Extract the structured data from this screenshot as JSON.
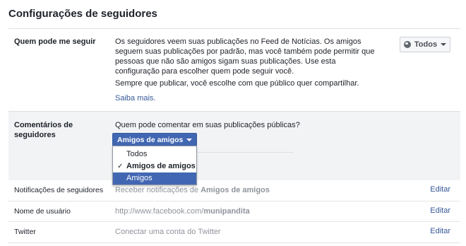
{
  "page_title": "Configurações de seguidores",
  "followers": {
    "label": "Quem pode me seguir",
    "description": "Os seguidores veem suas publicações no Feed de Notícias. Os amigos seguem suas publicações por padrão, mas você também pode permitir que pessoas que não são amigos sigam suas publicações. Use esta configuração para escolher quem pode seguir você.",
    "note": "Sempre que publicar, você escolhe com que público quer compartilhar.",
    "learn_more": "Saiba mais.",
    "button_label": "Todos"
  },
  "comments": {
    "label": "Comentários de seguidores",
    "question": "Quem pode comentar em suas publicações públicas?",
    "selected": "Amigos de amigos",
    "options": [
      {
        "label": "Todos",
        "checked": false,
        "highlighted": false
      },
      {
        "label": "Amigos de amigos",
        "checked": true,
        "highlighted": false
      },
      {
        "label": "Amigos",
        "checked": false,
        "highlighted": true
      }
    ]
  },
  "notifications": {
    "label": "Notificações de seguidores",
    "value_prefix": "Receber notificações de",
    "value_bold": "Amigos de amigos",
    "edit": "Editar"
  },
  "username": {
    "label": "Nome de usuário",
    "value_prefix": "http://www.facebook.com/",
    "value_bold": "munipandita",
    "edit": "Editar"
  },
  "twitter": {
    "label": "Twitter",
    "value": "Conectar uma conta do Twitter",
    "edit": "Editar"
  }
}
